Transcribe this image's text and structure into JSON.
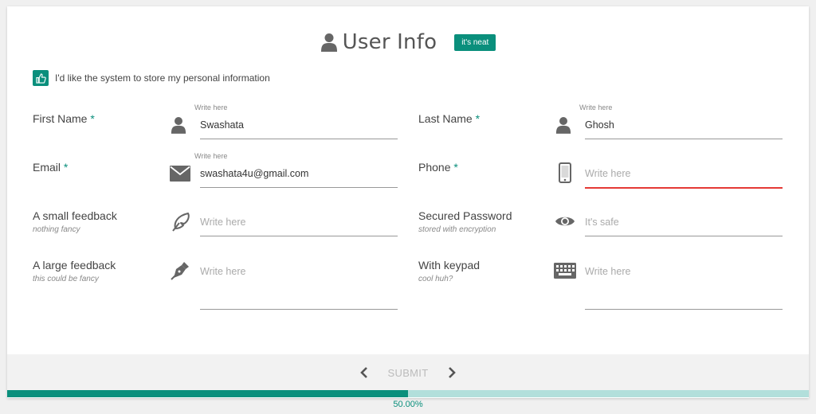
{
  "header": {
    "title": "User Info",
    "badge": "it's neat",
    "icon": "user-icon"
  },
  "consent": {
    "label": "I'd like the system to store my personal information",
    "checked": true,
    "icon": "thumbs-up-icon"
  },
  "fields": {
    "first_name": {
      "label": "First Name",
      "required_mark": "*",
      "hint": "Write here",
      "value": "Swashata",
      "icon": "user-icon"
    },
    "last_name": {
      "label": "Last Name",
      "required_mark": "*",
      "hint": "Write here",
      "value": "Ghosh",
      "icon": "user-icon"
    },
    "email": {
      "label": "Email",
      "required_mark": "*",
      "hint": "Write here",
      "value": "swashata4u@gmail.com",
      "icon": "envelope-icon"
    },
    "phone": {
      "label": "Phone",
      "required_mark": "*",
      "placeholder": "Write here",
      "icon": "mobile-icon"
    },
    "small_feedback": {
      "label": "A small feedback",
      "sublabel": "nothing fancy",
      "placeholder": "Write here",
      "icon": "feather-icon"
    },
    "password": {
      "label": "Secured Password",
      "sublabel": "stored with encryption",
      "placeholder": "It's safe",
      "icon": "eye-icon"
    },
    "large_feedback": {
      "label": "A large feedback",
      "sublabel": "this could be fancy",
      "placeholder": "Write here",
      "icon": "pen-nib-icon"
    },
    "keypad": {
      "label": "With keypad",
      "sublabel": "cool huh?",
      "placeholder": "Write here",
      "icon": "keyboard-icon"
    }
  },
  "footer": {
    "submit_label": "SUBMIT",
    "prev_icon": "chevron-left-icon",
    "next_icon": "chevron-right-icon"
  },
  "progress": {
    "value": 0.5,
    "label": "50.00%"
  },
  "colors": {
    "accent": "#0a8f7c",
    "error": "#e53935",
    "track": "#b2dfdb"
  }
}
